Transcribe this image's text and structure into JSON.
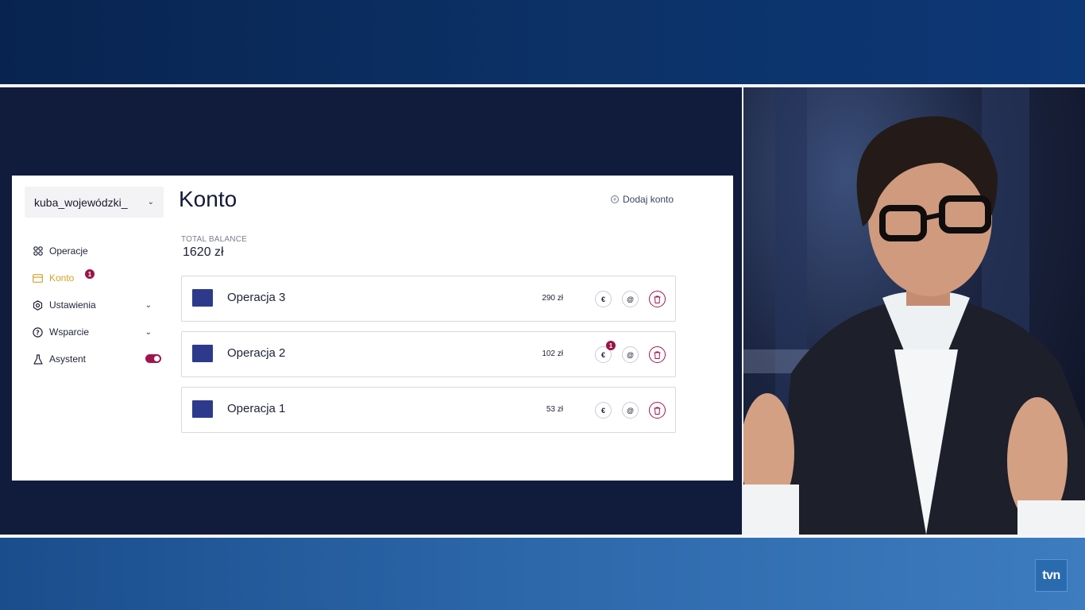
{
  "broadcast": {
    "channel_logo": "tvn"
  },
  "sidebar": {
    "user_label": "kuba_wojewódzki_",
    "items": [
      {
        "label": "Operacje",
        "icon": "grid-icon",
        "has_chevron": false,
        "badge": ""
      },
      {
        "label": "Konto",
        "icon": "card-icon",
        "has_chevron": false,
        "badge": "1",
        "active": true
      },
      {
        "label": "Ustawienia",
        "icon": "gear-icon",
        "has_chevron": true,
        "badge": ""
      },
      {
        "label": "Wsparcie",
        "icon": "help-circle-icon",
        "has_chevron": true,
        "badge": ""
      },
      {
        "label": "Asystent",
        "icon": "flask-icon",
        "has_chevron": false,
        "badge": "",
        "toggle_on": true
      }
    ]
  },
  "main": {
    "title": "Konto",
    "add_account_label": "Dodaj konto",
    "balance_label": "TOTAL BALANCE",
    "balance_value": "1620 zł",
    "operations": [
      {
        "name": "Operacja 3",
        "amount": "290 zł",
        "badge": ""
      },
      {
        "name": "Operacja 2",
        "amount": "102 zł",
        "badge": "1"
      },
      {
        "name": "Operacja 1",
        "amount": "53 zł",
        "badge": ""
      }
    ]
  },
  "colors": {
    "accent_active": "#d8a02a",
    "brand_magenta": "#a0154d",
    "thumb_blue": "#2d3a8c"
  }
}
